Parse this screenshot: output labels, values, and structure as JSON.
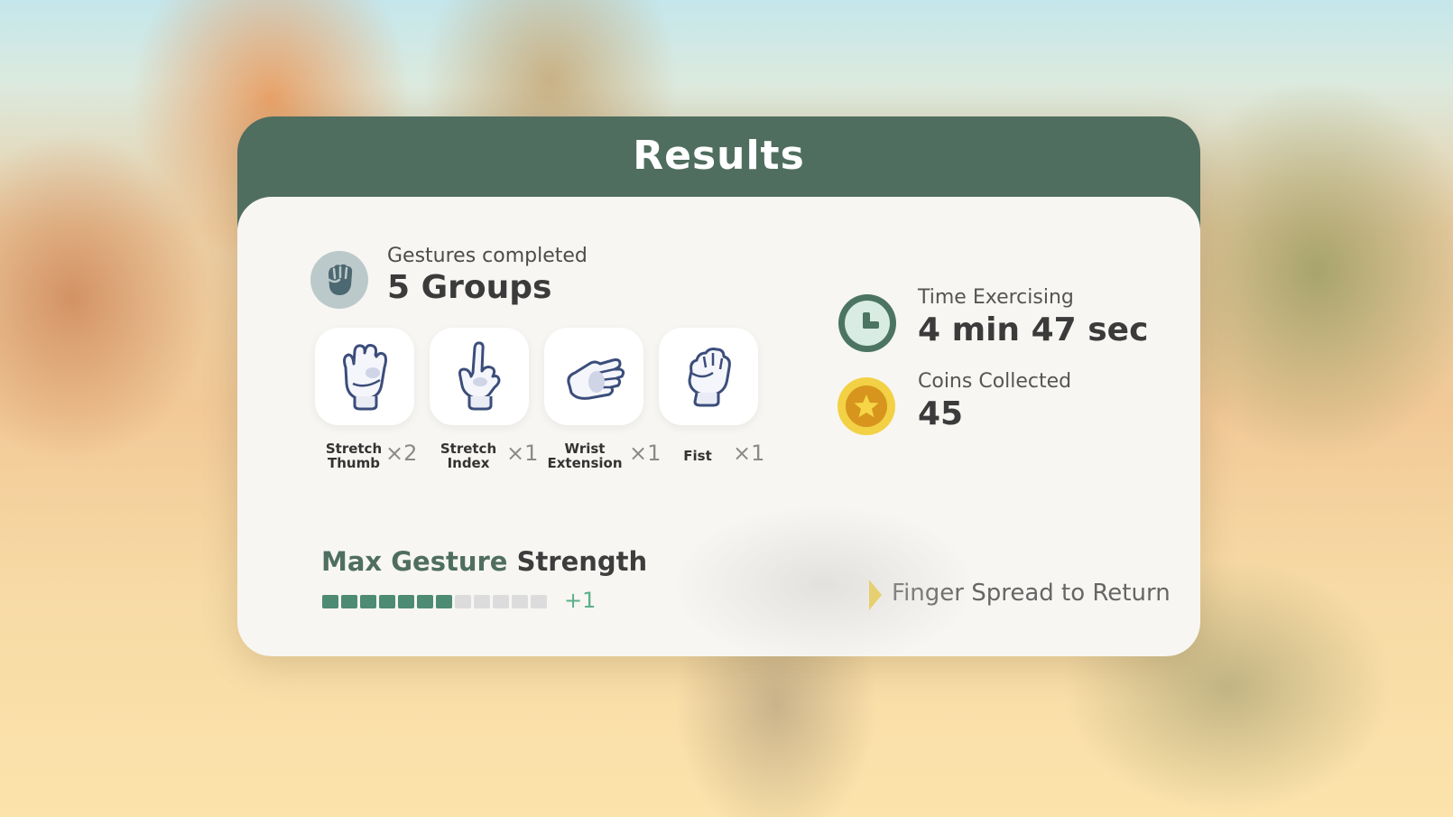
{
  "title": "Results",
  "gestures": {
    "label": "Gestures completed",
    "value": "5 Groups",
    "icon": "fist-icon",
    "items": [
      {
        "name_line1": "Stretch",
        "name_line2": "Thumb",
        "count": "×2",
        "icon": "open-hand-glove-icon"
      },
      {
        "name_line1": "Stretch",
        "name_line2": "Index",
        "count": "×1",
        "icon": "index-point-glove-icon"
      },
      {
        "name_line1": "Wrist",
        "name_line2": "Extension",
        "count": "×1",
        "icon": "wrist-extension-glove-icon"
      },
      {
        "name_line1": "Fist",
        "name_line2": "",
        "count": "×1",
        "icon": "fist-glove-icon"
      }
    ]
  },
  "time": {
    "label": "Time Exercising",
    "value": "4 min 47 sec",
    "icon": "clock-icon"
  },
  "coins": {
    "label": "Coins Collected",
    "value": "45",
    "icon": "coin-star-icon"
  },
  "strength": {
    "title_part1": "Max Gesture",
    "title_part2": "Strength",
    "level": 7,
    "max": 12,
    "delta": "+1"
  },
  "return_hint": "Finger Spread to Return",
  "colors": {
    "header": "#506e5f",
    "accent": "#4e8b74",
    "coin": "#f2d145"
  }
}
